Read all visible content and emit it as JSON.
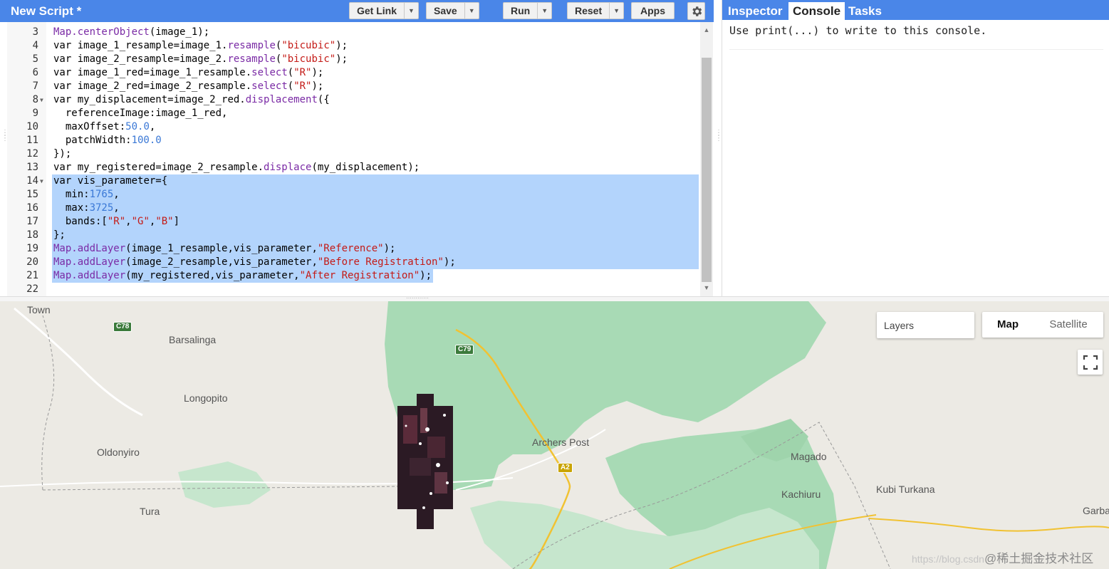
{
  "editor": {
    "title": "New Script *",
    "buttons": {
      "get_link": "Get Link",
      "save": "Save",
      "run": "Run",
      "reset": "Reset",
      "apps": "Apps"
    },
    "lines": [
      {
        "n": "3",
        "fold": false,
        "tokens": [
          {
            "t": "fn",
            "v": "Map.centerObject"
          },
          {
            "t": "p",
            "v": "(image_1);"
          }
        ]
      },
      {
        "n": "4",
        "fold": false,
        "tokens": [
          {
            "t": "kw",
            "v": "var"
          },
          {
            "t": "p",
            "v": " image_1_resample=image_1."
          },
          {
            "t": "fn",
            "v": "resample"
          },
          {
            "t": "p",
            "v": "("
          },
          {
            "t": "str",
            "v": "\"bicubic\""
          },
          {
            "t": "p",
            "v": ");"
          }
        ]
      },
      {
        "n": "5",
        "fold": false,
        "tokens": [
          {
            "t": "kw",
            "v": "var"
          },
          {
            "t": "p",
            "v": " image_2_resample=image_2."
          },
          {
            "t": "fn",
            "v": "resample"
          },
          {
            "t": "p",
            "v": "("
          },
          {
            "t": "str",
            "v": "\"bicubic\""
          },
          {
            "t": "p",
            "v": ");"
          }
        ]
      },
      {
        "n": "6",
        "fold": false,
        "tokens": [
          {
            "t": "kw",
            "v": "var"
          },
          {
            "t": "p",
            "v": " image_1_red=image_1_resample."
          },
          {
            "t": "fn",
            "v": "select"
          },
          {
            "t": "p",
            "v": "("
          },
          {
            "t": "str",
            "v": "\"R\""
          },
          {
            "t": "p",
            "v": ");"
          }
        ]
      },
      {
        "n": "7",
        "fold": false,
        "tokens": [
          {
            "t": "kw",
            "v": "var"
          },
          {
            "t": "p",
            "v": " image_2_red=image_2_resample."
          },
          {
            "t": "fn",
            "v": "select"
          },
          {
            "t": "p",
            "v": "("
          },
          {
            "t": "str",
            "v": "\"R\""
          },
          {
            "t": "p",
            "v": ");"
          }
        ]
      },
      {
        "n": "8",
        "fold": true,
        "tokens": [
          {
            "t": "kw",
            "v": "var"
          },
          {
            "t": "p",
            "v": " my_displacement=image_2_red."
          },
          {
            "t": "fn",
            "v": "displacement"
          },
          {
            "t": "p",
            "v": "({"
          }
        ]
      },
      {
        "n": "9",
        "fold": false,
        "tokens": [
          {
            "t": "p",
            "v": "  referenceImage:image_1_red,"
          }
        ]
      },
      {
        "n": "10",
        "fold": false,
        "tokens": [
          {
            "t": "p",
            "v": "  maxOffset:"
          },
          {
            "t": "num",
            "v": "50.0"
          },
          {
            "t": "p",
            "v": ","
          }
        ]
      },
      {
        "n": "11",
        "fold": false,
        "tokens": [
          {
            "t": "p",
            "v": "  patchWidth:"
          },
          {
            "t": "num",
            "v": "100.0"
          }
        ]
      },
      {
        "n": "12",
        "fold": false,
        "tokens": [
          {
            "t": "p",
            "v": "});"
          }
        ]
      },
      {
        "n": "13",
        "fold": false,
        "tokens": [
          {
            "t": "kw",
            "v": "var"
          },
          {
            "t": "p",
            "v": " my_registered=image_2_resample."
          },
          {
            "t": "fn",
            "v": "displace"
          },
          {
            "t": "p",
            "v": "(my_displacement);"
          }
        ]
      },
      {
        "n": "14",
        "fold": true,
        "tokens": [
          {
            "t": "kw",
            "v": "var"
          },
          {
            "t": "p",
            "v": " vis_parameter={"
          }
        ]
      },
      {
        "n": "15",
        "fold": false,
        "tokens": [
          {
            "t": "p",
            "v": "  min:"
          },
          {
            "t": "num",
            "v": "1765"
          },
          {
            "t": "p",
            "v": ","
          }
        ]
      },
      {
        "n": "16",
        "fold": false,
        "tokens": [
          {
            "t": "p",
            "v": "  max:"
          },
          {
            "t": "num",
            "v": "3725"
          },
          {
            "t": "p",
            "v": ","
          }
        ]
      },
      {
        "n": "17",
        "fold": false,
        "tokens": [
          {
            "t": "p",
            "v": "  bands:["
          },
          {
            "t": "str",
            "v": "\"R\""
          },
          {
            "t": "p",
            "v": ","
          },
          {
            "t": "str",
            "v": "\"G\""
          },
          {
            "t": "p",
            "v": ","
          },
          {
            "t": "str",
            "v": "\"B\""
          },
          {
            "t": "p",
            "v": "]"
          }
        ]
      },
      {
        "n": "18",
        "fold": false,
        "tokens": [
          {
            "t": "p",
            "v": "};"
          }
        ]
      },
      {
        "n": "19",
        "fold": false,
        "tokens": [
          {
            "t": "fn",
            "v": "Map.addLayer"
          },
          {
            "t": "p",
            "v": "(image_1_resample,vis_parameter,"
          },
          {
            "t": "str",
            "v": "\"Reference\""
          },
          {
            "t": "p",
            "v": ");"
          }
        ]
      },
      {
        "n": "20",
        "fold": false,
        "tokens": [
          {
            "t": "fn",
            "v": "Map.addLayer"
          },
          {
            "t": "p",
            "v": "(image_2_resample,vis_parameter,"
          },
          {
            "t": "str",
            "v": "\"Before Registration\""
          },
          {
            "t": "p",
            "v": ");"
          }
        ]
      },
      {
        "n": "21",
        "fold": false,
        "tokens": [
          {
            "t": "fn",
            "v": "Map.addLayer"
          },
          {
            "t": "p",
            "v": "(my_registered,vis_parameter,"
          },
          {
            "t": "str",
            "v": "\"After Registration\""
          },
          {
            "t": "p",
            "v": ");"
          }
        ]
      },
      {
        "n": "22",
        "fold": false,
        "tokens": []
      }
    ],
    "selected_lines": [
      "14",
      "15",
      "16",
      "17",
      "18",
      "19",
      "20",
      "21"
    ]
  },
  "right_panel": {
    "tabs": [
      "Inspector",
      "Console",
      "Tasks"
    ],
    "active_tab": "Console",
    "console_message": "Use print(...) to write to this console."
  },
  "map": {
    "places": {
      "town": "Town",
      "barsalinga": "Barsalinga",
      "longopito": "Longopito",
      "oldonyiro": "Oldonyiro",
      "tura": "Tura",
      "archers_post": "Archers Post",
      "magado": "Magado",
      "kachiuru": "Kachiuru",
      "kubi_turkana": "Kubi Turkana",
      "garba": "Garba"
    },
    "roads": {
      "c78": "C78",
      "c79": "C79",
      "a2": "A2"
    },
    "layers_button": "Layers",
    "map_types": {
      "map": "Map",
      "satellite": "Satellite"
    },
    "selected_map_type": "Map",
    "watermark_url": "https://blog.csdn",
    "watermark_text": "@稀土掘金技术社区"
  },
  "colors": {
    "header_blue": "#4a86e8",
    "selection": "#b3d4fc",
    "park_green": "#a8dab5"
  }
}
